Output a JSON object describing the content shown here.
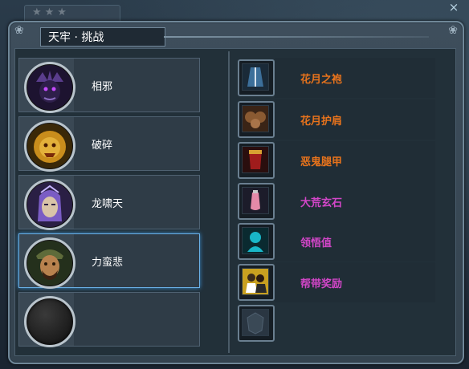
{
  "window": {
    "title": "天牢 · 挑战",
    "close": "×"
  },
  "heroes": [
    {
      "name": "相邪",
      "avatar_icon": "demon-lord-icon",
      "selected": false
    },
    {
      "name": "破碎",
      "avatar_icon": "golden-lion-icon",
      "selected": false
    },
    {
      "name": "龙啸天",
      "avatar_icon": "purple-warrior-icon",
      "selected": false
    },
    {
      "name": "力蛮悲",
      "avatar_icon": "bearded-warrior-icon",
      "selected": true
    },
    {
      "name": "",
      "avatar_icon": "empty-slot-icon",
      "selected": false
    }
  ],
  "rewards": [
    {
      "label": "花月之袍",
      "color": "#e8731c",
      "icon": "robe-icon"
    },
    {
      "label": "花月护肩",
      "color": "#e8731c",
      "icon": "shoulder-guard-icon"
    },
    {
      "label": "恶鬼腿甲",
      "color": "#e8731c",
      "icon": "leg-armor-icon"
    },
    {
      "label": "大荒玄石",
      "color": "#d246c8",
      "icon": "gem-bottle-icon"
    },
    {
      "label": "领悟值",
      "color": "#d246c8",
      "icon": "insight-icon"
    },
    {
      "label": "帮带奖励",
      "color": "#d246c8",
      "icon": "guild-reward-icon"
    },
    {
      "label": "",
      "color": "#e8731c",
      "icon": "empty-reward-slot-icon"
    }
  ]
}
